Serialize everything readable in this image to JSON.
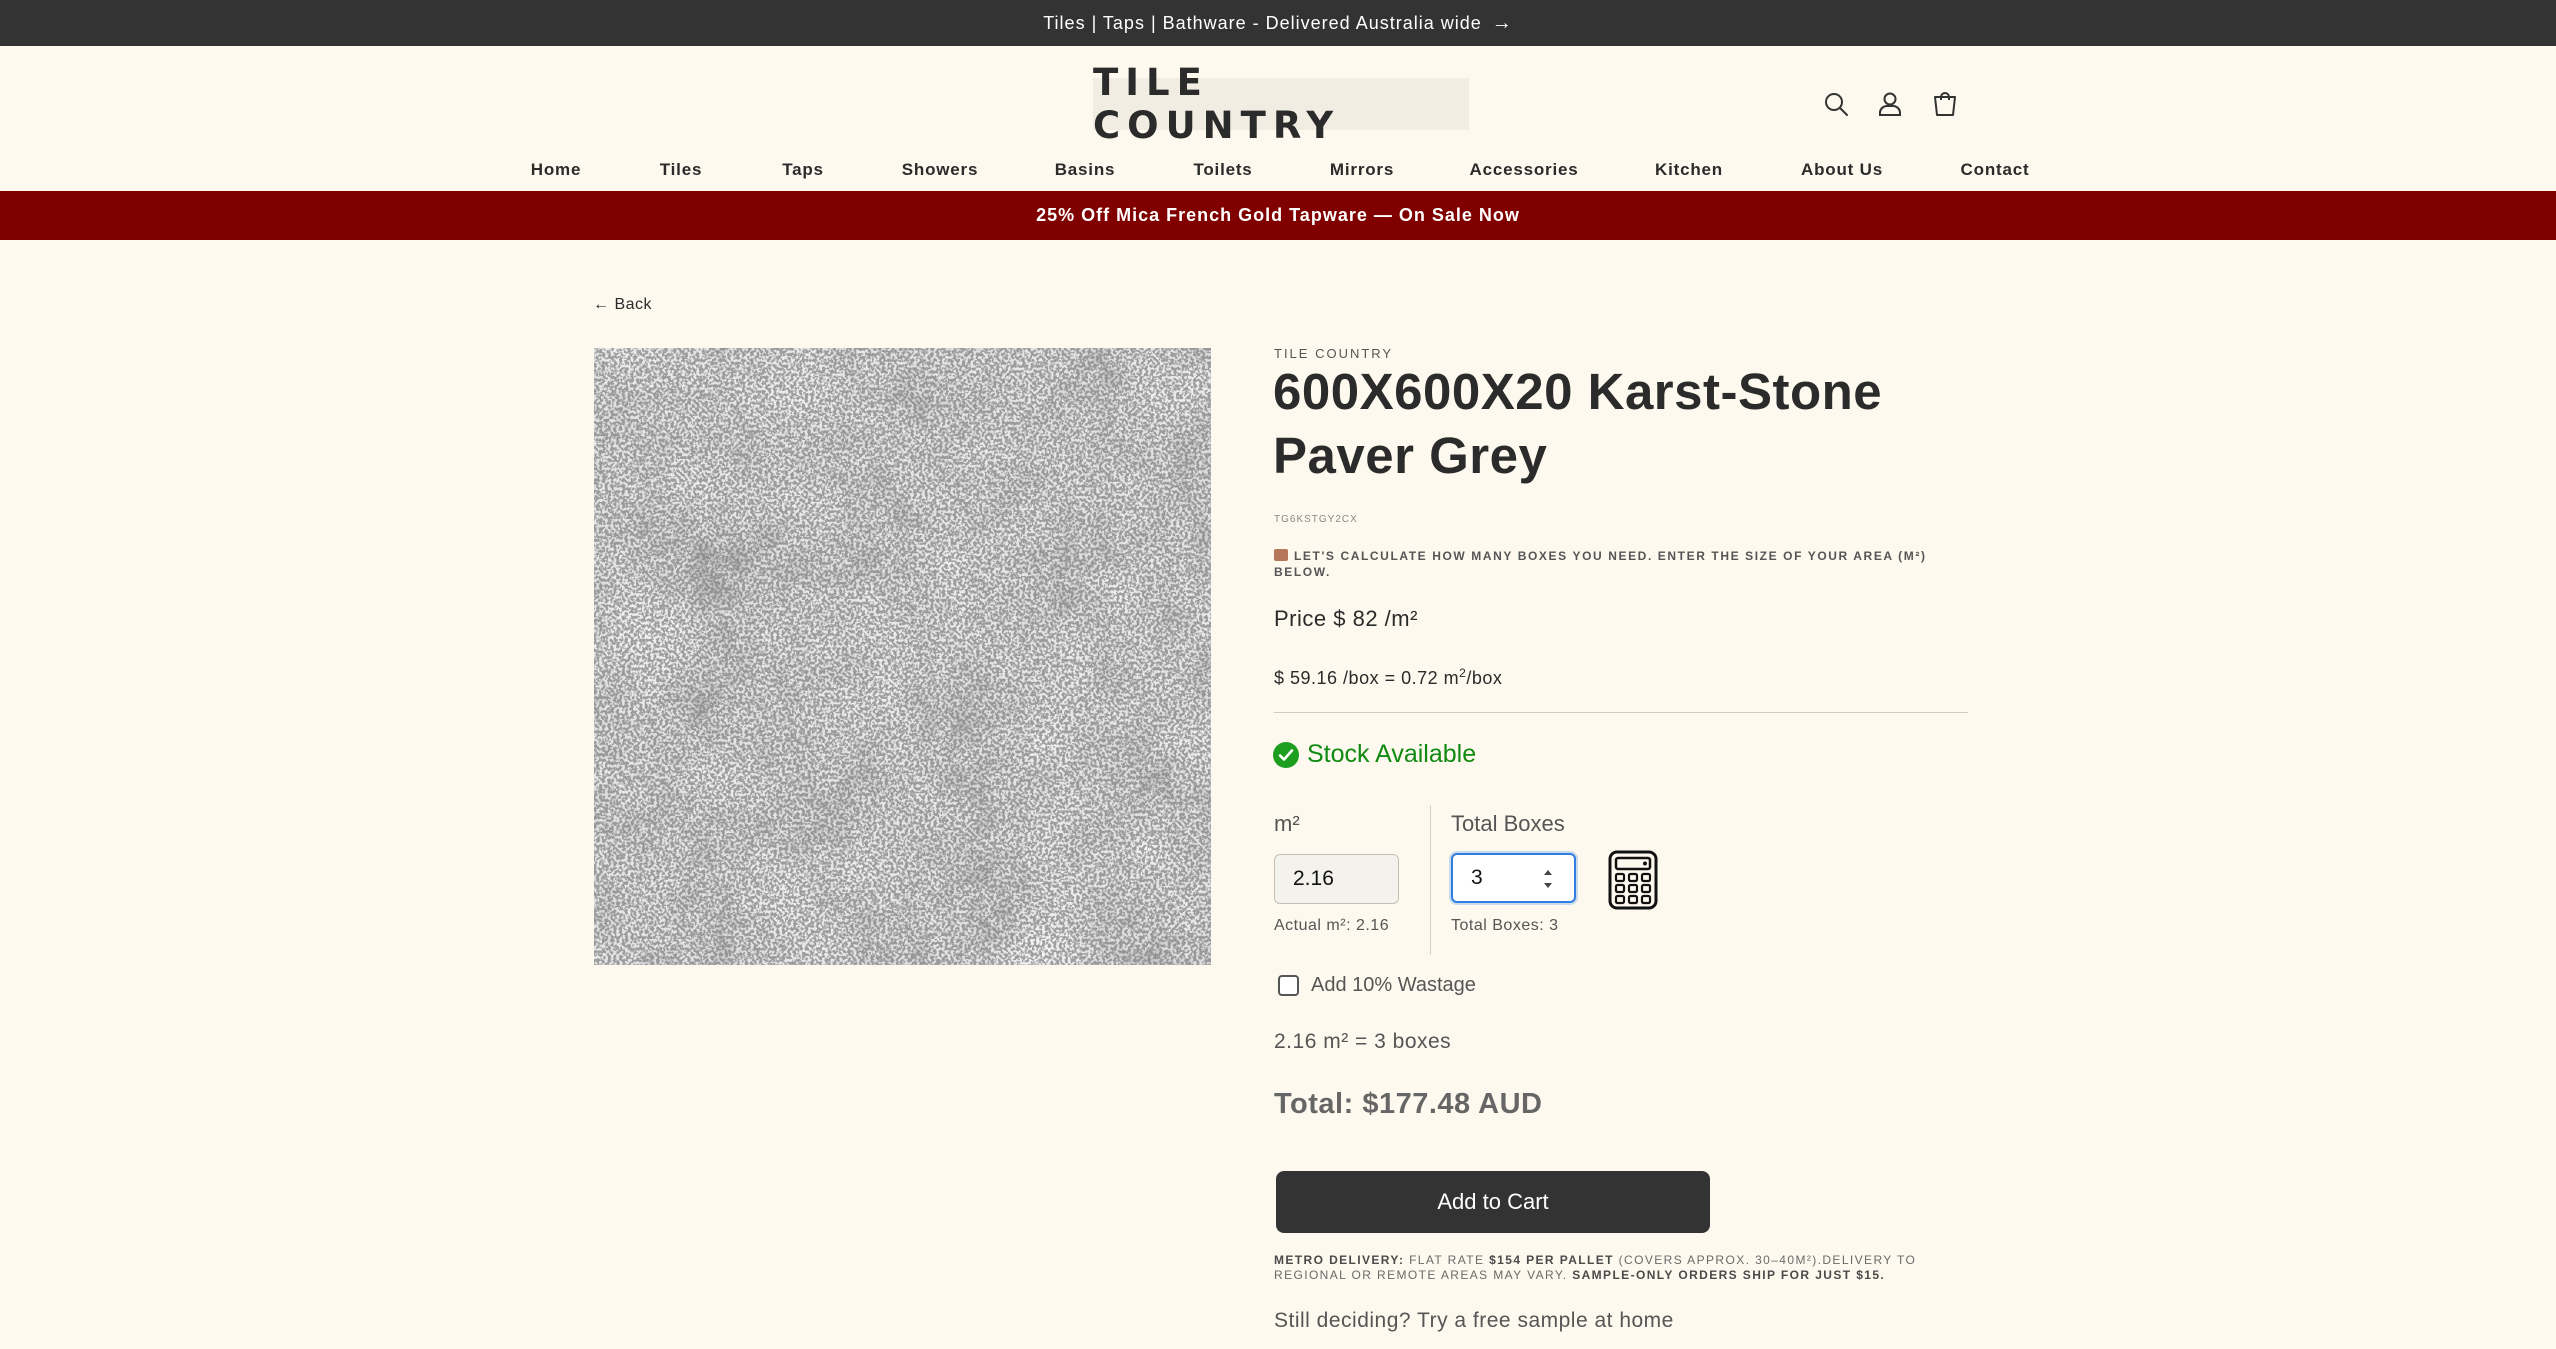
{
  "announcement": {
    "text": "Tiles | Taps | Bathware - Delivered Australia wide",
    "arrow": "→"
  },
  "header": {
    "logo_text": "TILE COUNTRY",
    "icons": [
      "search-icon",
      "account-icon",
      "cart-icon"
    ]
  },
  "nav": {
    "items": [
      {
        "label": "Home"
      },
      {
        "label": "Tiles"
      },
      {
        "label": "Taps"
      },
      {
        "label": "Showers"
      },
      {
        "label": "Basins"
      },
      {
        "label": "Toilets"
      },
      {
        "label": "Mirrors"
      },
      {
        "label": "Accessories"
      },
      {
        "label": "Kitchen"
      },
      {
        "label": "About Us"
      },
      {
        "label": "Contact"
      }
    ]
  },
  "promo": {
    "text": "25% Off Mica French Gold Tapware — On Sale Now"
  },
  "back_link": "← Back",
  "product": {
    "vendor": "TILE COUNTRY",
    "title": "600X600X20 Karst-Stone Paver Grey",
    "sku": "TG6KSTGY2CX",
    "calc_note": "LET'S CALCULATE HOW MANY BOXES YOU NEED. ENTER THE SIZE OF YOUR AREA (M²) BELOW.",
    "price": "Price $ 82 /m²",
    "per_box_prefix": "$ 59.16 /box = 0.72 m",
    "per_box_sup": "2",
    "per_box_suffix": "/box",
    "stock": "Stock Available"
  },
  "calculator": {
    "m2_label": "m²",
    "m2_value": "2.16",
    "actual_m2": "Actual m²: 2.16",
    "boxes_label": "Total Boxes",
    "boxes_value": "3",
    "total_boxes": "Total Boxes: 3",
    "wastage_label": "Add 10% Wastage",
    "wastage_checked": false,
    "summary": "2.16 m² = 3 boxes",
    "total": "Total: $177.48 AUD"
  },
  "cart_button": "Add to Cart",
  "delivery": {
    "label": "METRO DELIVERY:",
    "text1": " FLAT RATE ",
    "rate": "$154 PER PALLET",
    "text2": " (COVERS APPROX. 30–40M²).DELIVERY TO REGIONAL OR REMOTE AREAS MAY VARY. ",
    "sample_note": "SAMPLE-ONLY ORDERS SHIP FOR JUST $15."
  },
  "sample_link": "Still deciding? Try a free sample at home",
  "colors": {
    "announcement_bg": "#333333",
    "promo_bg": "#800000",
    "page_bg": "#fdf9ee",
    "stock_green": "#118a11",
    "button_bg": "#333333",
    "focus_blue": "#2f7fe0"
  }
}
